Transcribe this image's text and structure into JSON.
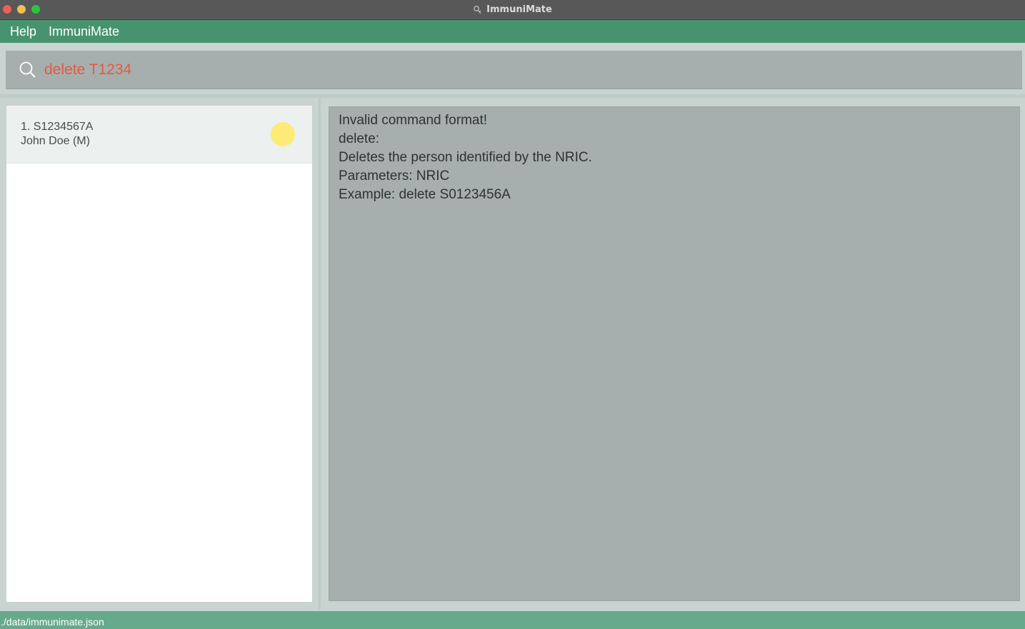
{
  "window": {
    "title": "ImmuniMate"
  },
  "menu": {
    "items": [
      "Help",
      "ImmuniMate"
    ]
  },
  "command": {
    "value": "delete T1234",
    "text_color": "#e35a43"
  },
  "person_list": [
    {
      "index": "1.",
      "nric": "S1234567A",
      "name_line": "John Doe (M)",
      "status_color": "#fcec77"
    }
  ],
  "result": {
    "lines": [
      "Invalid command format!",
      "delete:",
      "Deletes the person identified by the NRIC.",
      "Parameters: NRIC",
      "Example: delete S0123456A"
    ]
  },
  "status_bar": {
    "path": "./data/immunimate.json"
  },
  "colors": {
    "accent": "#48936f",
    "status_bar": "#67a98b",
    "panel_grey": "#a6afad"
  },
  "icons": {
    "search": "search-icon",
    "app": "app-icon"
  }
}
